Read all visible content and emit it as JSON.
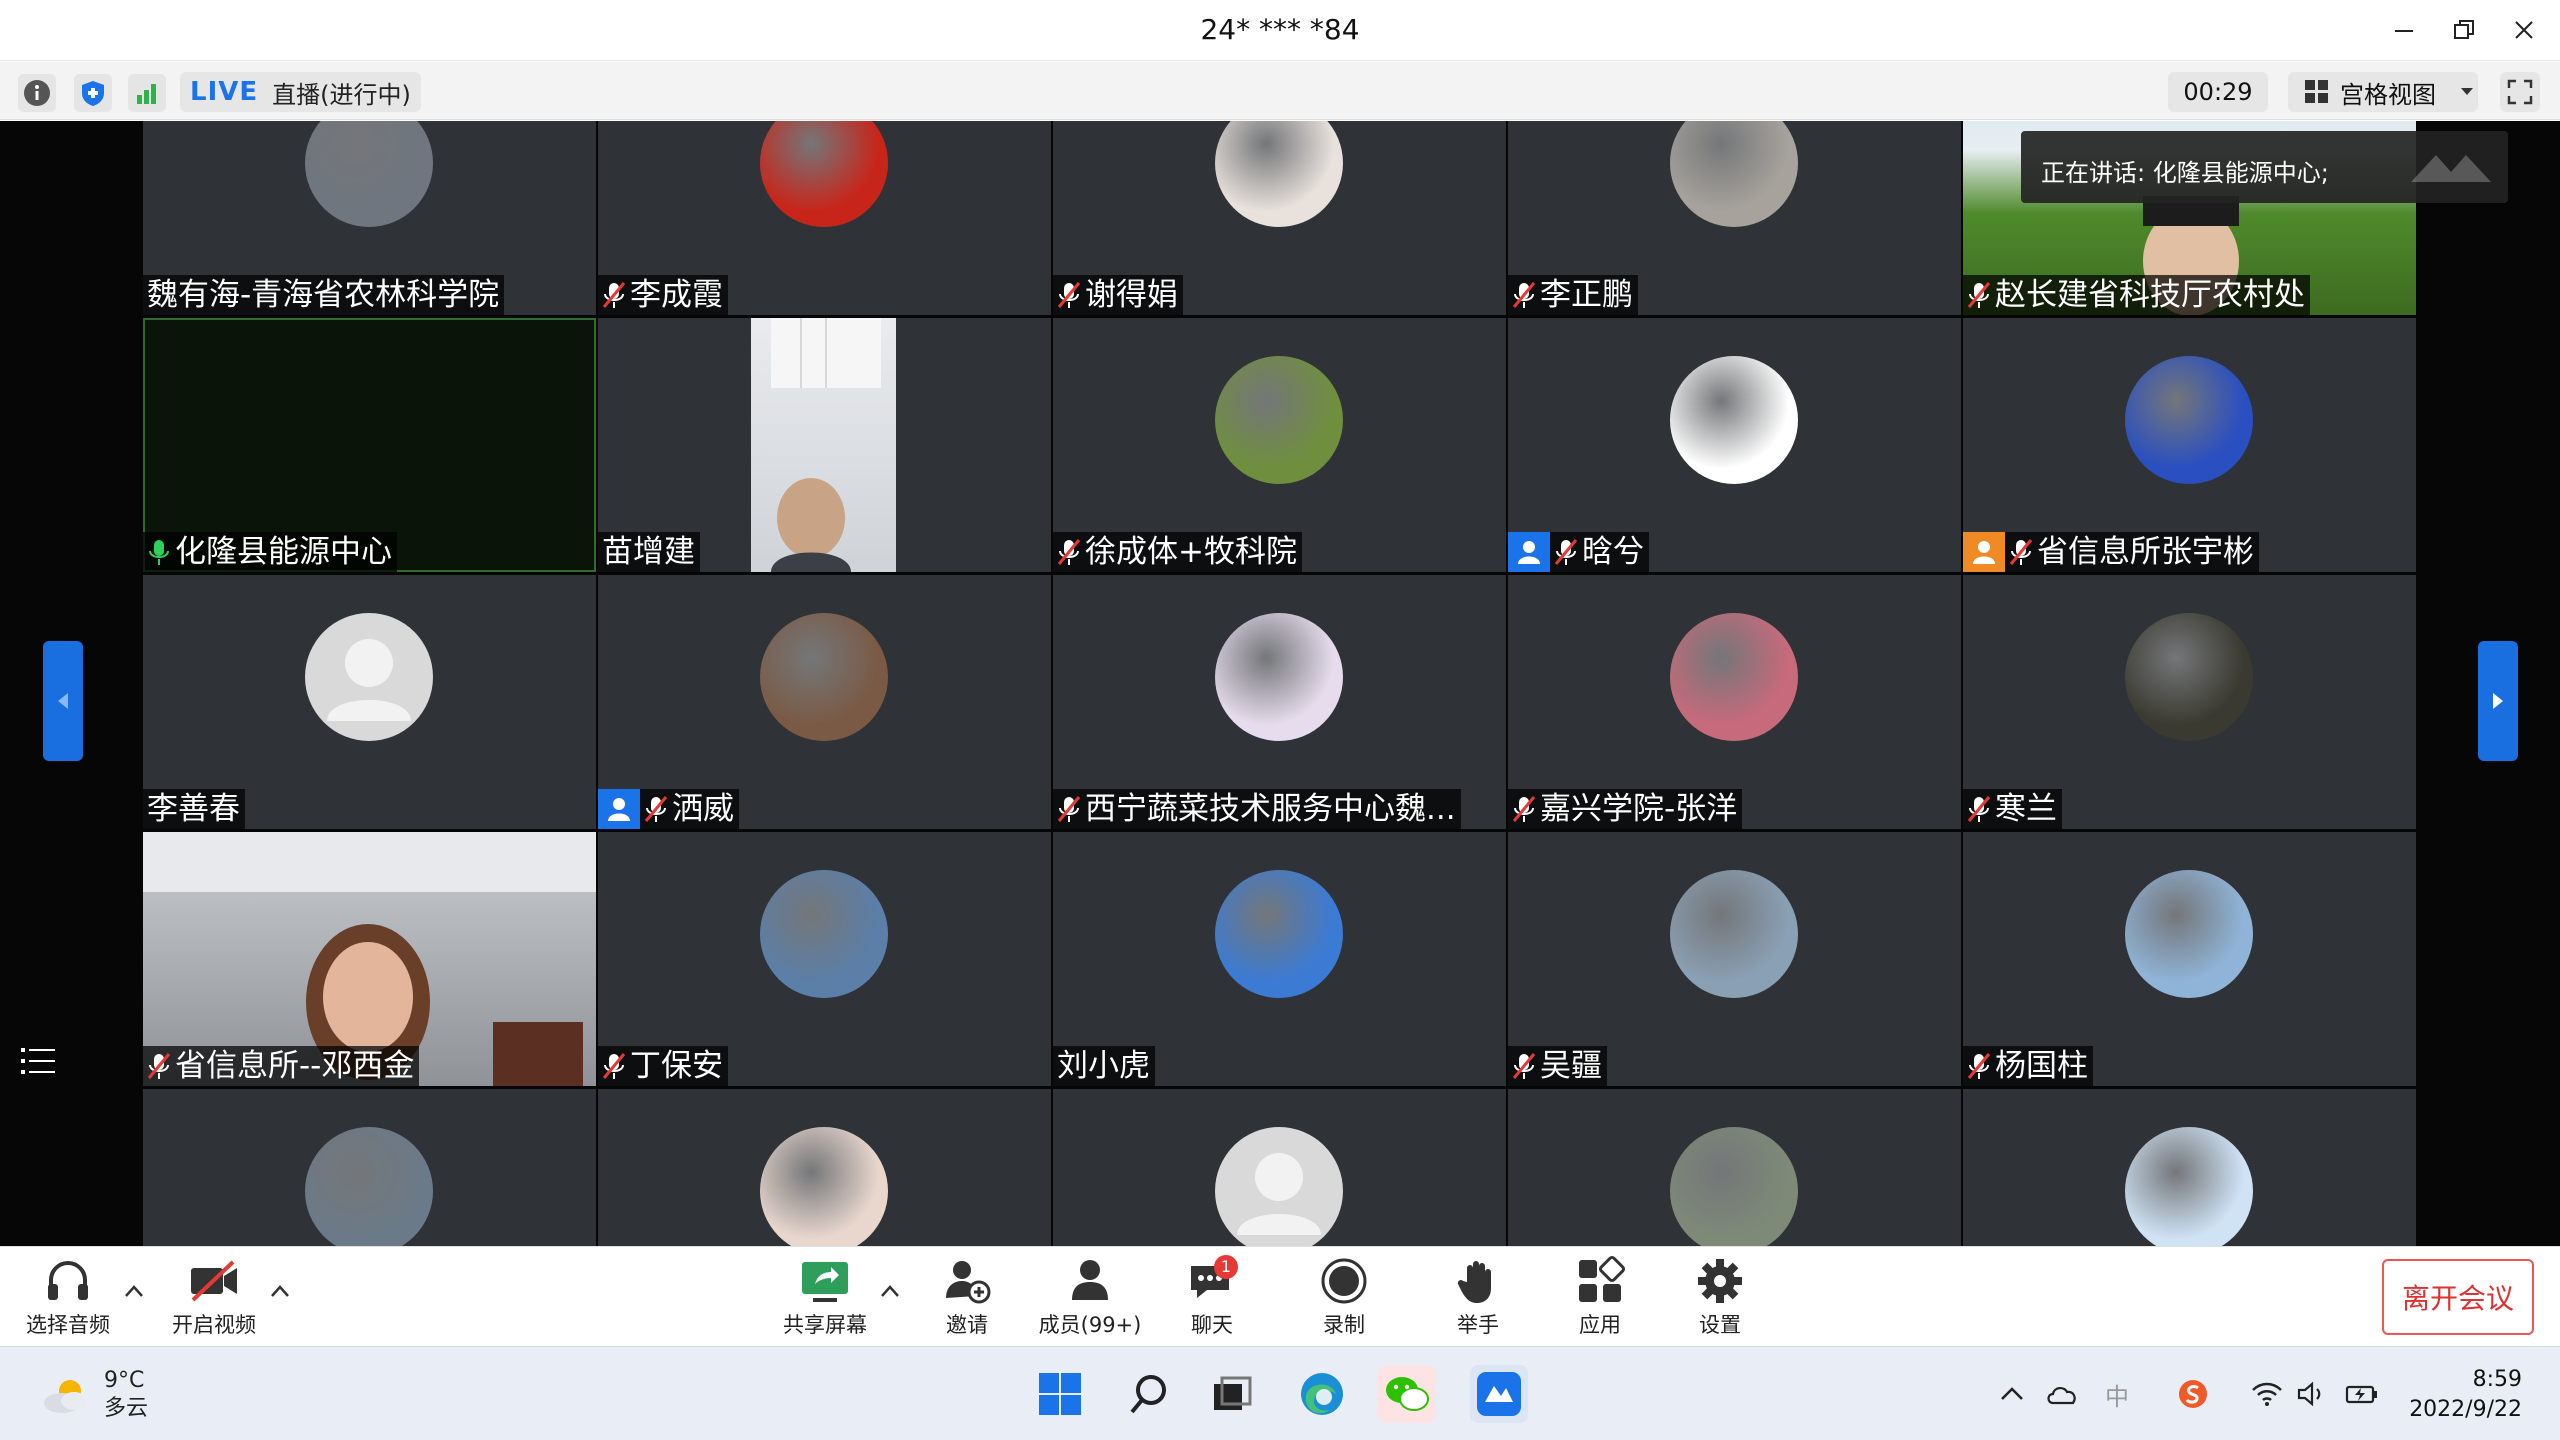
{
  "window": {
    "title": "24* *** *84"
  },
  "toolbar": {
    "live_tag": "LIVE",
    "live_status": "直播(进行中)",
    "timer": "00:29",
    "view_label": "宫格视图"
  },
  "speaking": "正在讲话: 化隆县能源中心;",
  "tiles": [
    {
      "name": "魏有海-青海省农林科学院",
      "mic": "none",
      "host": false,
      "avatar": "motorcycle-rider",
      "color": "#6f7680",
      "video": false
    },
    {
      "name": "李成霞",
      "mic": "muted",
      "host": false,
      "avatar": "red-maple",
      "color": "#c8251a",
      "video": false
    },
    {
      "name": "谢得娟",
      "mic": "muted",
      "host": false,
      "avatar": "anime-girl",
      "color": "#e8e1dc",
      "video": false
    },
    {
      "name": "李正鹏",
      "mic": "muted",
      "host": false,
      "avatar": "gate-landmark",
      "color": "#a7a39c",
      "video": false
    },
    {
      "name": "赵长建省科技厅农村处",
      "mic": "muted",
      "host": false,
      "avatar": "",
      "color": "#5a8a3a",
      "video": "landscape-person"
    },
    {
      "name": "化隆县能源中心",
      "mic": "active",
      "host": false,
      "avatar": "",
      "color": "#0a1408",
      "video": "dark"
    },
    {
      "name": "苗增建",
      "mic": "none",
      "host": false,
      "avatar": "",
      "color": "#2f3236",
      "video": "man-office"
    },
    {
      "name": "徐成体+牧科院",
      "mic": "muted",
      "host": false,
      "avatar": "green-field",
      "color": "#6f8f3e",
      "video": false
    },
    {
      "name": "晗兮",
      "mic": "muted",
      "host": true,
      "avatar": "cartoon-girl",
      "color": "#ffffff",
      "video": false
    },
    {
      "name": "省信息所张宇彬",
      "mic": "muted",
      "host": "orange",
      "avatar": "blue-bear",
      "color": "#2a4fc0",
      "video": false
    },
    {
      "name": "李善春",
      "mic": "none",
      "host": false,
      "avatar": "default",
      "color": "#d9d9d9",
      "video": false
    },
    {
      "name": "洒威",
      "mic": "muted",
      "host": true,
      "avatar": "morel-mushroom",
      "color": "#7a5a45",
      "video": false
    },
    {
      "name": "西宁蔬菜技术服务中心魏...",
      "mic": "muted",
      "host": false,
      "avatar": "girl-purple",
      "color": "#e6dced",
      "video": false
    },
    {
      "name": "嘉兴学院-张洋",
      "mic": "muted",
      "host": false,
      "avatar": "tulips",
      "color": "#c76a7b",
      "video": false
    },
    {
      "name": "寒兰",
      "mic": "muted",
      "host": false,
      "avatar": "yellow-orchid",
      "color": "#3a3a30",
      "video": false
    },
    {
      "name": "省信息所--邓西金",
      "mic": "muted",
      "host": false,
      "avatar": "",
      "color": "#9a9da2",
      "video": "woman-office"
    },
    {
      "name": "丁保安",
      "mic": "muted",
      "host": false,
      "avatar": "coastal-town",
      "color": "#5b7fa8",
      "video": false
    },
    {
      "name": "刘小虎",
      "mic": "none",
      "host": false,
      "avatar": "blue-clouds",
      "color": "#3b7bd4",
      "video": false
    },
    {
      "name": "吴疆",
      "mic": "muted",
      "host": false,
      "avatar": "bean-sculpture",
      "color": "#8aa0b4",
      "video": false
    },
    {
      "name": "杨国柱",
      "mic": "muted",
      "host": false,
      "avatar": "boy-yellow",
      "color": "#8fb4d8",
      "video": false
    },
    {
      "name": "",
      "mic": "none",
      "host": false,
      "avatar": "snow-mountain",
      "color": "#6b7a88",
      "video": false
    },
    {
      "name": "",
      "mic": "none",
      "host": false,
      "avatar": "woman-portrait",
      "color": "#e9d7ce",
      "video": false
    },
    {
      "name": "",
      "mic": "none",
      "host": false,
      "avatar": "default",
      "color": "#d9d9d9",
      "video": false
    },
    {
      "name": "",
      "mic": "none",
      "host": false,
      "avatar": "hills",
      "color": "#7d8a78",
      "video": false
    },
    {
      "name": "",
      "mic": "none",
      "host": false,
      "avatar": "cartoon-boy",
      "color": "#cfe3f5",
      "video": false
    }
  ],
  "bottom_tools": {
    "audio": "选择音频",
    "video": "开启视频",
    "share": "共享屏幕",
    "invite": "邀请",
    "members": "成员(99+)",
    "chat": "聊天",
    "chat_badge": "1",
    "record": "录制",
    "raise": "举手",
    "apps": "应用",
    "settings": "设置",
    "leave": "离开会议"
  },
  "taskbar": {
    "temp": "9°C",
    "weather": "多云",
    "ime": "中",
    "time": "8:59",
    "date": "2022/9/22"
  },
  "colors": {
    "accent": "#1a73e8",
    "leave": "#e03030",
    "tile_bg": "#2f3236"
  }
}
